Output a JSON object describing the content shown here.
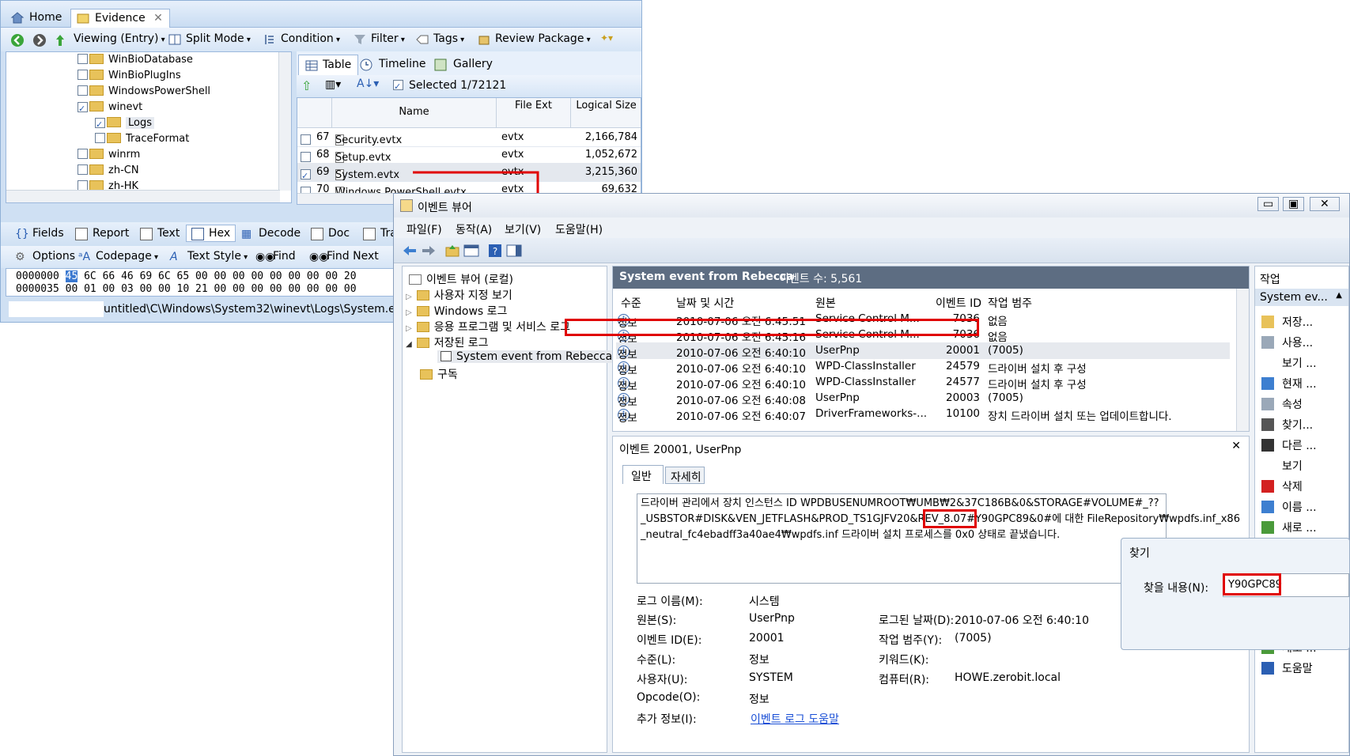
{
  "encase": {
    "tabs": [
      "Home",
      "Evidence"
    ],
    "toolbar": [
      "Viewing (Entry)",
      "Split Mode",
      "Condition",
      "Filter",
      "Tags",
      "Review Package"
    ],
    "tree": [
      {
        "label": "WinBioDatabase",
        "checked": false
      },
      {
        "label": "WinBioPlugIns",
        "checked": false
      },
      {
        "label": "WindowsPowerShell",
        "checked": false
      },
      {
        "label": "winevt",
        "checked": true
      },
      {
        "label": "Logs",
        "checked": true
      },
      {
        "label": "TraceFormat",
        "checked": false
      },
      {
        "label": "winrm",
        "checked": false
      },
      {
        "label": "zh-CN",
        "checked": false
      },
      {
        "label": "zh-HK",
        "checked": false
      }
    ],
    "view_tabs": [
      "Table",
      "Timeline",
      "Gallery"
    ],
    "selected": "Selected 1/72121",
    "columns": {
      "name": "Name",
      "ext": "File Ext",
      "size": "Logical Size"
    },
    "rows": [
      {
        "num": "67",
        "name": "Security.evtx",
        "ext": "evtx",
        "size": "2,166,784",
        "checked": false
      },
      {
        "num": "68",
        "name": "Setup.evtx",
        "ext": "evtx",
        "size": "1,052,672",
        "checked": false
      },
      {
        "num": "69",
        "name": "System.evtx",
        "ext": "evtx",
        "size": "3,215,360",
        "checked": true
      },
      {
        "num": "70",
        "name": "Windows PowerShell.evtx",
        "ext": "evtx",
        "size": "69,632",
        "checked": false
      }
    ],
    "bottom_tabs": [
      "Fields",
      "Report",
      "Text",
      "Hex",
      "Decode",
      "Doc",
      "Tra"
    ],
    "bottom_toolbar": [
      "Options",
      "Codepage",
      "Text Style",
      "Find",
      "Find Next"
    ],
    "hex": [
      {
        "offset": "0000000",
        "bytes": [
          "45",
          "6C",
          "66",
          "46",
          "69",
          "6C",
          "65",
          "00",
          "00",
          "00",
          "00",
          "00",
          "00",
          "00",
          "00",
          "20"
        ]
      },
      {
        "offset": "0000035",
        "bytes": [
          "00",
          "01",
          "00",
          "03",
          "00",
          "00",
          "10",
          "21",
          "00",
          "00",
          "00",
          "00",
          "00",
          "00",
          "00",
          "00"
        ]
      }
    ],
    "path": "untitled\\C\\Windows\\System32\\winevt\\Logs\\System.evtx ("
  },
  "event_viewer": {
    "title": "이벤트 뷰어",
    "menu": [
      "파일(F)",
      "동작(A)",
      "보기(V)",
      "도움말(H)"
    ],
    "nav": [
      "이벤트 뷰어 (로컬)",
      "사용자 지정 보기",
      "Windows 로그",
      "응용 프로그램 및 서비스 로그",
      "저장된 로그",
      "System event from Rebecca",
      "구독"
    ],
    "log_title": "System event from Rebecca",
    "event_count": "이벤트 수: 5,561",
    "columns": [
      "수준",
      "날짜 및 시간",
      "원본",
      "이벤트 ID",
      "작업 범주"
    ],
    "events": [
      {
        "level": "정보",
        "date": "2010-07-06 오전 6:45:51",
        "source": "Service Control M...",
        "id": "7036",
        "cat": "없음"
      },
      {
        "level": "정보",
        "date": "2010-07-06 오전 6:45:16",
        "source": "Service Control M...",
        "id": "7036",
        "cat": "없음"
      },
      {
        "level": "정보",
        "date": "2010-07-06 오전 6:40:10",
        "source": "UserPnp",
        "id": "20001",
        "cat": "(7005)"
      },
      {
        "level": "정보",
        "date": "2010-07-06 오전 6:40:10",
        "source": "WPD-ClassInstaller",
        "id": "24579",
        "cat": "드라이버 설치 후 구성"
      },
      {
        "level": "정보",
        "date": "2010-07-06 오전 6:40:10",
        "source": "WPD-ClassInstaller",
        "id": "24577",
        "cat": "드라이버 설치 후 구성"
      },
      {
        "level": "정보",
        "date": "2010-07-06 오전 6:40:08",
        "source": "UserPnp",
        "id": "20003",
        "cat": "(7005)"
      },
      {
        "level": "정보",
        "date": "2010-07-06 오전 6:40:07",
        "source": "DriverFrameworks-...",
        "id": "10100",
        "cat": "장치 드라이버 설치 또는 업데이트합니다."
      }
    ],
    "detail_title": "이벤트 20001, UserPnp",
    "detail_tabs": [
      "일반",
      "자세히"
    ],
    "message": {
      "line1": "드라이버 관리에서 장치 인스턴스 ID WPDBUSENUMROOT₩UMB₩2&37C186B&0&STORAGE#VOLUME#_??",
      "line2a": "_USBSTOR#DISK&VEN_JETFLASH&PROD_TS1GJFV20&REV_8.07#",
      "line2b": "Y90GPC89",
      "line2c": "&0#에 대한 FileRepository₩wpdfs.inf_x86",
      "line3": "_neutral_fc4ebadff3a40ae4₩wpdfs.inf 드라이버 설치 프로세스를 0x0 상태로 끝냈습니다."
    },
    "props": {
      "log_name_label": "로그 이름(M):",
      "log_name": "시스템",
      "source_label": "원본(S):",
      "source": "UserPnp",
      "logged_label": "로그된 날짜(D):",
      "logged": "2010-07-06 오전 6:40:10",
      "id_label": "이벤트 ID(E):",
      "id": "20001",
      "task_label": "작업 범주(Y):",
      "task": "(7005)",
      "level_label": "수준(L):",
      "level": "정보",
      "keyword_label": "키워드(K):",
      "user_label": "사용자(U):",
      "user": "SYSTEM",
      "computer_label": "컴퓨터(R):",
      "computer": "HOWE.zerobit.local",
      "opcode_label": "Opcode(O):",
      "opcode": "정보",
      "more_label": "추가 정보(I):",
      "more_link": "이벤트 로그 도움말"
    },
    "actions_title": "작업",
    "actions_header": "System ev...",
    "actions": [
      "저장...",
      "사용...",
      "보기 ...",
      "현재 ...",
      "속성",
      "찾기...",
      "다른 ...",
      "보기",
      "삭제",
      "이름 ...",
      "새로 ...",
      "새로 ...",
      "도움말"
    ],
    "find": {
      "title": "찾기",
      "label": "찾을 내용(N):",
      "value": "Y90GPC89"
    }
  }
}
